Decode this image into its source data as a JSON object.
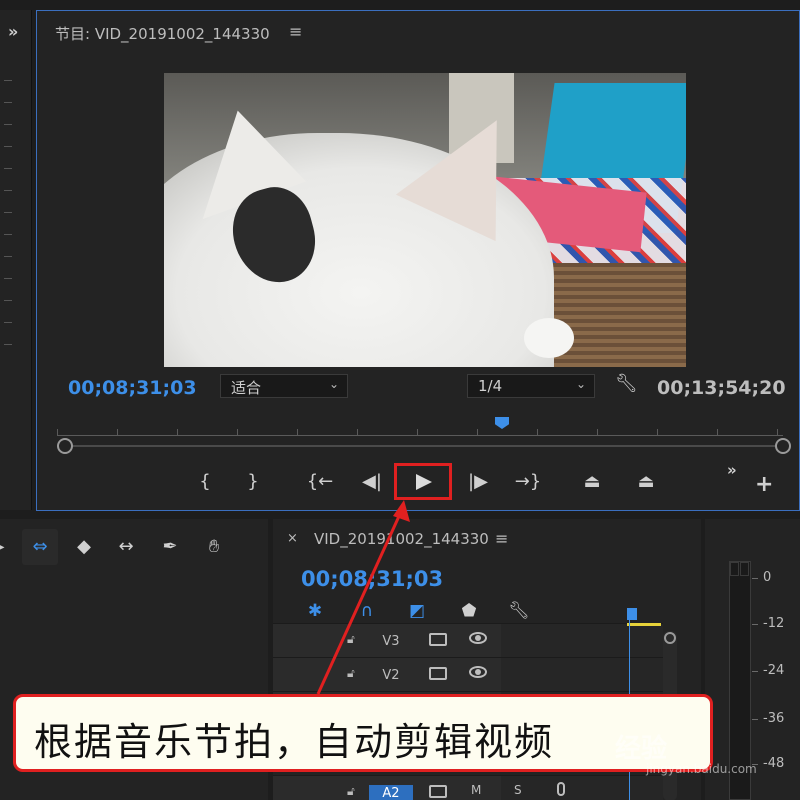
{
  "program_monitor": {
    "title": "节目: VID_20191002_144330",
    "menu_icon": "hamburger-menu-icon",
    "timecode_current": "00;08;31;03",
    "timecode_duration": "00;13;54;20",
    "fit_label": "适合",
    "resolution_label": "1/4",
    "transport": {
      "mark_in": "{",
      "mark_out": "}",
      "go_to_in": "{←",
      "step_back": "◀|",
      "step_forward": "|▶",
      "go_to_out": "→}",
      "more": "»",
      "add": "+"
    }
  },
  "left_strip": {
    "expand": "»"
  },
  "timeline": {
    "close": "×",
    "title": "VID_20191002_144330",
    "timecode": "00;08;31;03",
    "tracks": [
      {
        "name": "V3"
      },
      {
        "name": "V2"
      },
      {
        "name": "A2",
        "mute": "M",
        "solo": "S"
      }
    ]
  },
  "audio_meter": {
    "scale": [
      "0",
      "-12",
      "-24",
      "-36",
      "-48"
    ]
  },
  "callout": {
    "text": "根据音乐节拍，自动剪辑视频"
  },
  "watermark": {
    "text": "经验",
    "url": "jingyan.baidu.com"
  },
  "colors": {
    "accent_blue": "#3d8fe8",
    "highlight_red": "#e02020",
    "panel_bg": "#232323"
  }
}
